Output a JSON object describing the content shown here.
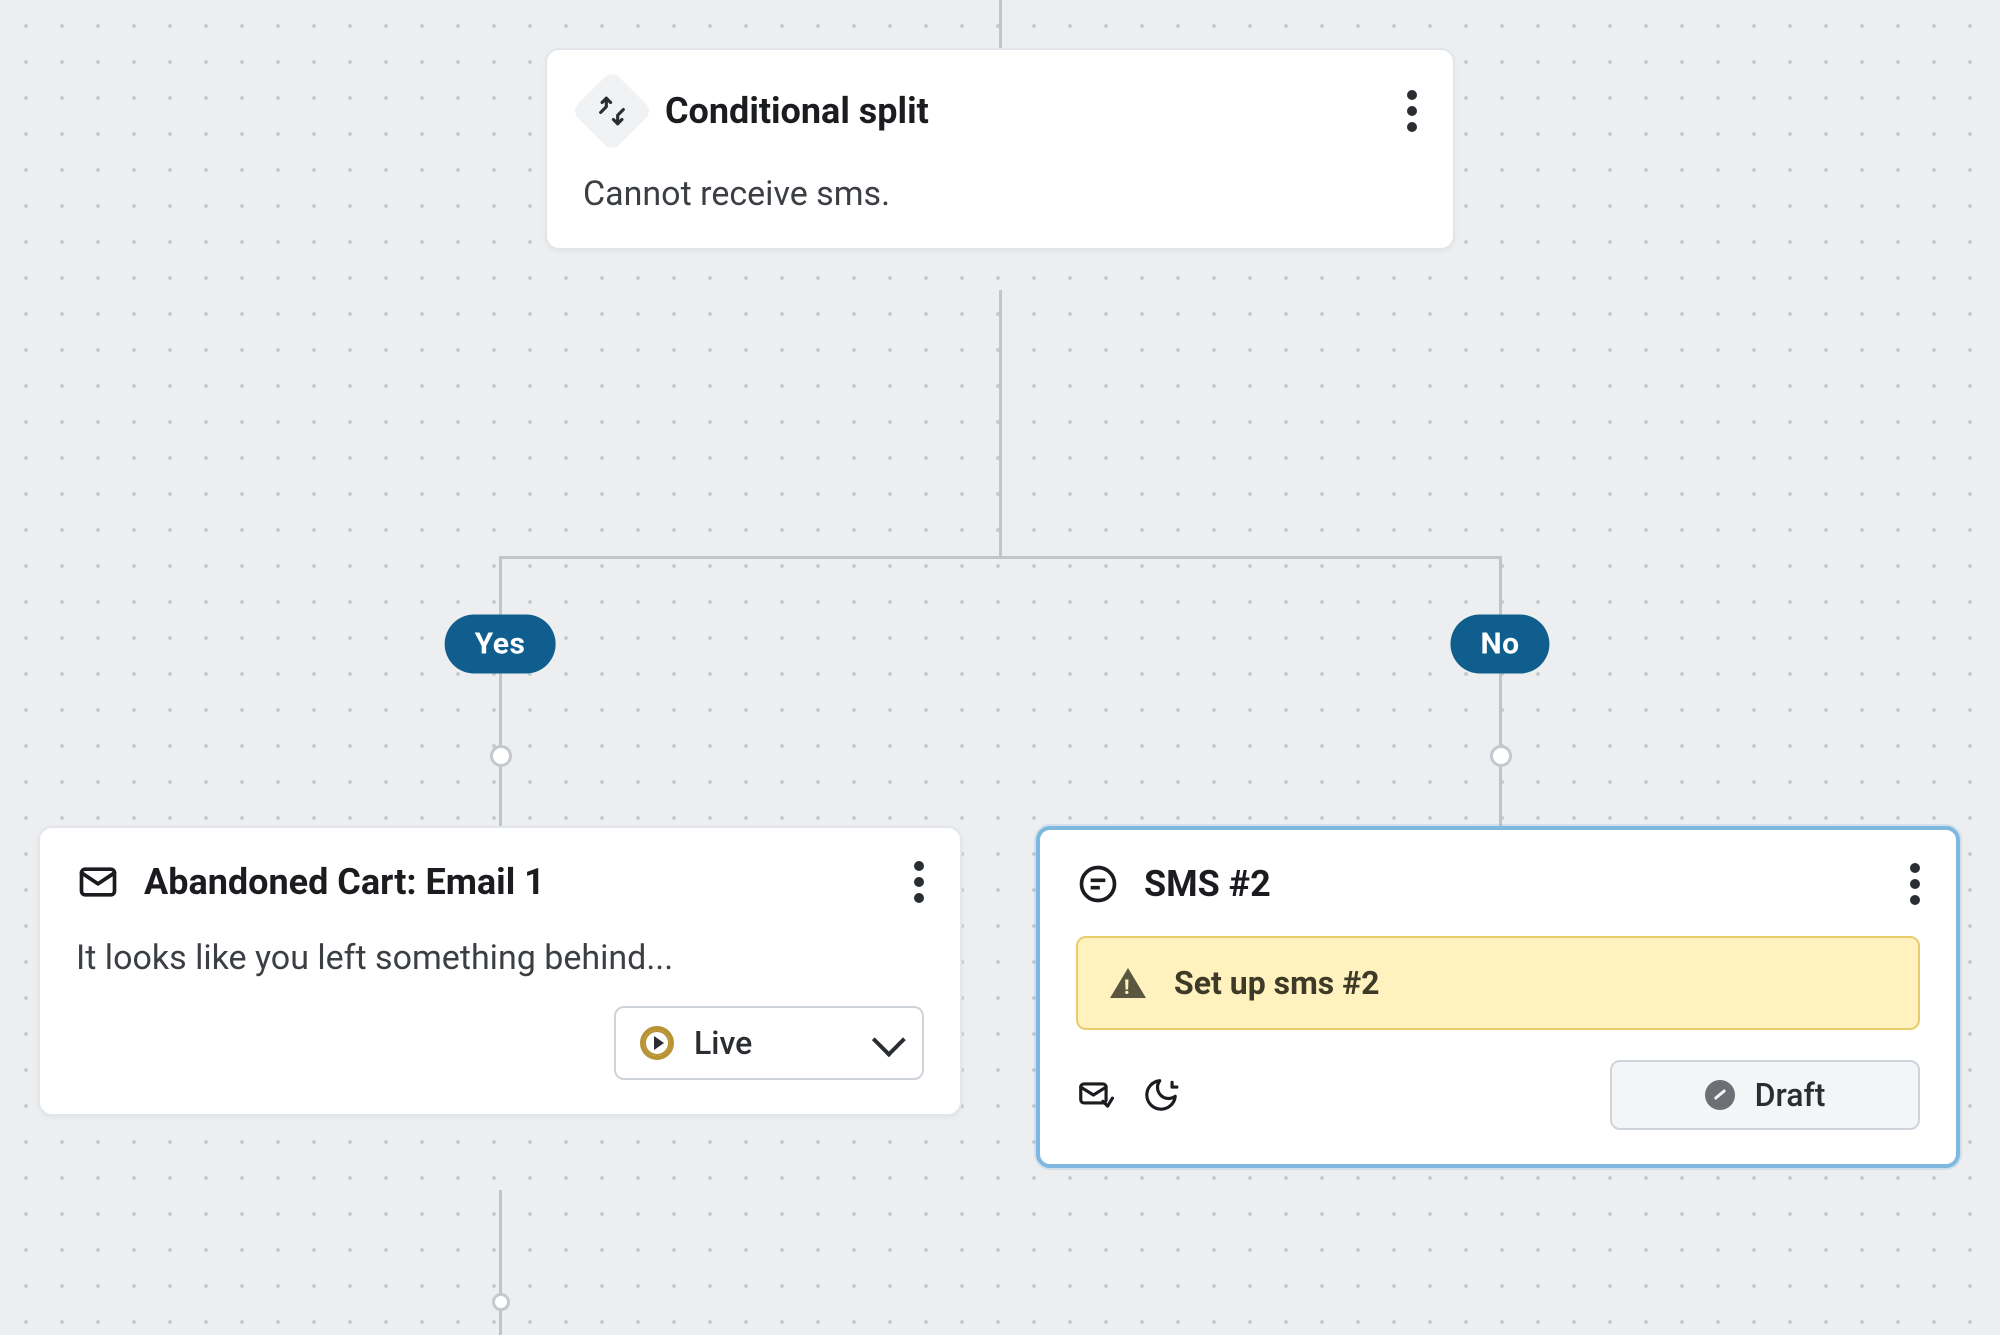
{
  "nodes": {
    "conditional": {
      "title": "Conditional split",
      "description": "Cannot receive sms."
    },
    "branches": {
      "yes": "Yes",
      "no": "No"
    },
    "email": {
      "title": "Abandoned Cart: Email 1",
      "description": "It looks like you left something behind...",
      "status": "Live"
    },
    "sms": {
      "title": "SMS #2",
      "warning": "Set up sms #2",
      "status": "Draft"
    }
  }
}
